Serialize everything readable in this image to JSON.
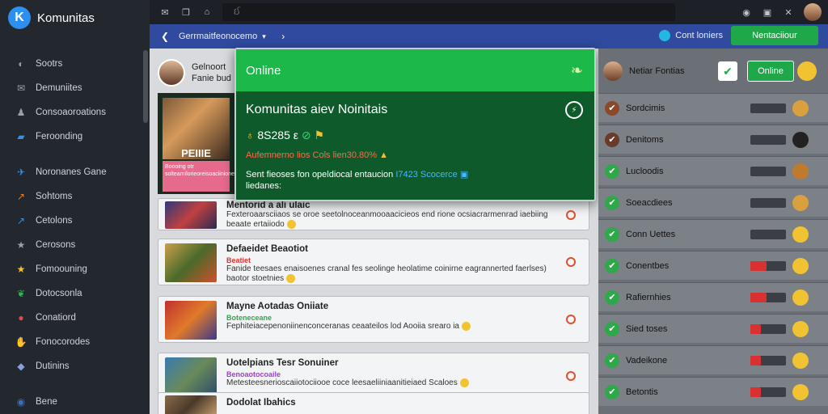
{
  "app": {
    "name": "Komunitas"
  },
  "sidebar": {
    "items": [
      {
        "label": "Sootrs",
        "icon": "gamepad-icon",
        "color": "#9aa0a8"
      },
      {
        "label": "Demuniites",
        "icon": "chat-icon",
        "color": "#9aa0a8"
      },
      {
        "label": "Consoaoroations",
        "icon": "users-icon",
        "color": "#9aa0a8"
      },
      {
        "label": "Feroonding",
        "icon": "folder-icon",
        "color": "#3b8ee0"
      },
      {
        "label": "Noronanes Gane",
        "icon": "controller-icon",
        "color": "#3b8ee0"
      },
      {
        "label": "Sohtoms",
        "icon": "signal-icon",
        "color": "#e0802a"
      },
      {
        "label": "Cetolons",
        "icon": "trend-icon",
        "color": "#3b8ee0"
      },
      {
        "label": "Cerosons",
        "icon": "star-icon",
        "color": "#9aa0a8"
      },
      {
        "label": "Fomoouning",
        "icon": "star-icon",
        "color": "#f1c232"
      },
      {
        "label": "Dotocsonla",
        "icon": "leaf-icon",
        "color": "#2fb84f"
      },
      {
        "label": "Conatiord",
        "icon": "avatar-icon",
        "color": "#e04a4a"
      },
      {
        "label": "Fonocorodes",
        "icon": "thumb-icon",
        "color": "#f1c232"
      },
      {
        "label": "Dutinins",
        "icon": "badge-icon",
        "color": "#8aa0e0"
      },
      {
        "label": "Bene",
        "icon": "user-circle-icon",
        "color": "#3b70c0"
      }
    ]
  },
  "topbar": {
    "search_placeholder": "ઈ"
  },
  "subbar": {
    "breadcrumb": "Gerrmaitfeonocemo",
    "contact_label": "Cont loniers",
    "join_label": "Nentaciiour"
  },
  "feed": {
    "author_name": "Gelnoort",
    "author_sub": "Fanie bud",
    "left_card": {
      "label": "PEIIIE",
      "caption": "Boooing otr solteamilorieoreisoaciinionerions"
    },
    "posts": [
      {
        "title": "Mentorid a ali ulaic",
        "sub": "",
        "sub_color": "#d9342b",
        "desc": "Fexteroaarsciiaos se oroe seetolnoceanmooaacicieos end rione ocsiacrarmenrad iaebiing beaate ertaiiodo",
        "thumb": "linear-gradient(135deg,#2a3a7a,#c04040,#2a2a50)"
      },
      {
        "title": "Defaeidet Beaotiot",
        "sub": "Beatiet",
        "sub_color": "#d9342b",
        "desc": "Fanide teesaes enaisoenes cranal fes seolinge heolatime coinirne eagrannerted faerlses) baotor stoetnies",
        "thumb": "linear-gradient(135deg,#c9a04a,#4a6a2a,#d0502a)"
      },
      {
        "title": "Mayne Aotadas Oniiate",
        "sub": "Boteneceane",
        "sub_color": "#2fa84a",
        "desc": "Fephiteiacepenoniinenconceranas ceaateilos lod Aooiia srearo ia",
        "thumb": "linear-gradient(135deg,#c03030,#e07a2a,#3a3a8a)"
      },
      {
        "title": "Uotelpians Tesr Sonuiner",
        "sub": "Benoaotocoaile",
        "sub_color": "#a23ad0",
        "desc": "Metesteesnerioscaiiotociiooe coce leesaeliiniaanitieiaed Scaloes",
        "thumb": "linear-gradient(135deg,#3a7ab0,#6a8a5a,#2a4a6a)"
      },
      {
        "title": "Dodolat Ibahics",
        "sub": "",
        "sub_color": "#2fa84a",
        "desc": "",
        "thumb": "linear-gradient(135deg,#8a6a4a,#4a3a2a,#c09a6a)"
      }
    ]
  },
  "overlay": {
    "header": "Online",
    "title": "Komunitas aiev Noinitais",
    "stats": "8S285 ε",
    "warning": "Aufemnerno lios Cols lien30.80%",
    "desc_a": "Sent fieoses fon opeldiocal entaucion",
    "desc_highlight": "I7423 Scocerce",
    "desc_b": "liedanes:"
  },
  "rpanel": {
    "header_name": "Netiar Fontias",
    "online_label": "Online",
    "members": [
      {
        "name": "Sordcimis",
        "icon_color": "#8a4a2a",
        "bar": 0.0,
        "bar_color": "#3b3e44",
        "face_color": "#d9a040"
      },
      {
        "name": "Denitoms",
        "icon_color": "#6a3a2a",
        "bar": 0.0,
        "bar_color": "#3b3e44",
        "face_color": "#222222"
      },
      {
        "name": "Lucloodis",
        "icon_color": "#2fa84a",
        "bar": 0.0,
        "bar_color": "#3b3e44",
        "face_color": "#c07a30"
      },
      {
        "name": "Soeacdiees",
        "icon_color": "#2fa84a",
        "bar": 0.0,
        "bar_color": "#3b3e44",
        "face_color": "#d9a040"
      },
      {
        "name": "Conn Uettes",
        "icon_color": "#2fa84a",
        "bar": 0.0,
        "bar_color": "#3b3e44",
        "face_color": "#f1c232"
      },
      {
        "name": "Conentbes",
        "icon_color": "#2fa84a",
        "bar": 0.45,
        "bar_color": "#d93030",
        "face_color": "#f1c232"
      },
      {
        "name": "Rafiernhies",
        "icon_color": "#2fa84a",
        "bar": 0.45,
        "bar_color": "#d93030",
        "face_color": "#f1c232"
      },
      {
        "name": "Sied toses",
        "icon_color": "#2fa84a",
        "bar": 0.3,
        "bar_color": "#d93030",
        "face_color": "#f1c232"
      },
      {
        "name": "Vadeikone",
        "icon_color": "#2fa84a",
        "bar": 0.3,
        "bar_color": "#d93030",
        "face_color": "#f1c232"
      },
      {
        "name": "Betontis",
        "icon_color": "#2fa84a",
        "bar": 0.3,
        "bar_color": "#d93030",
        "face_color": "#f1c232"
      }
    ]
  }
}
